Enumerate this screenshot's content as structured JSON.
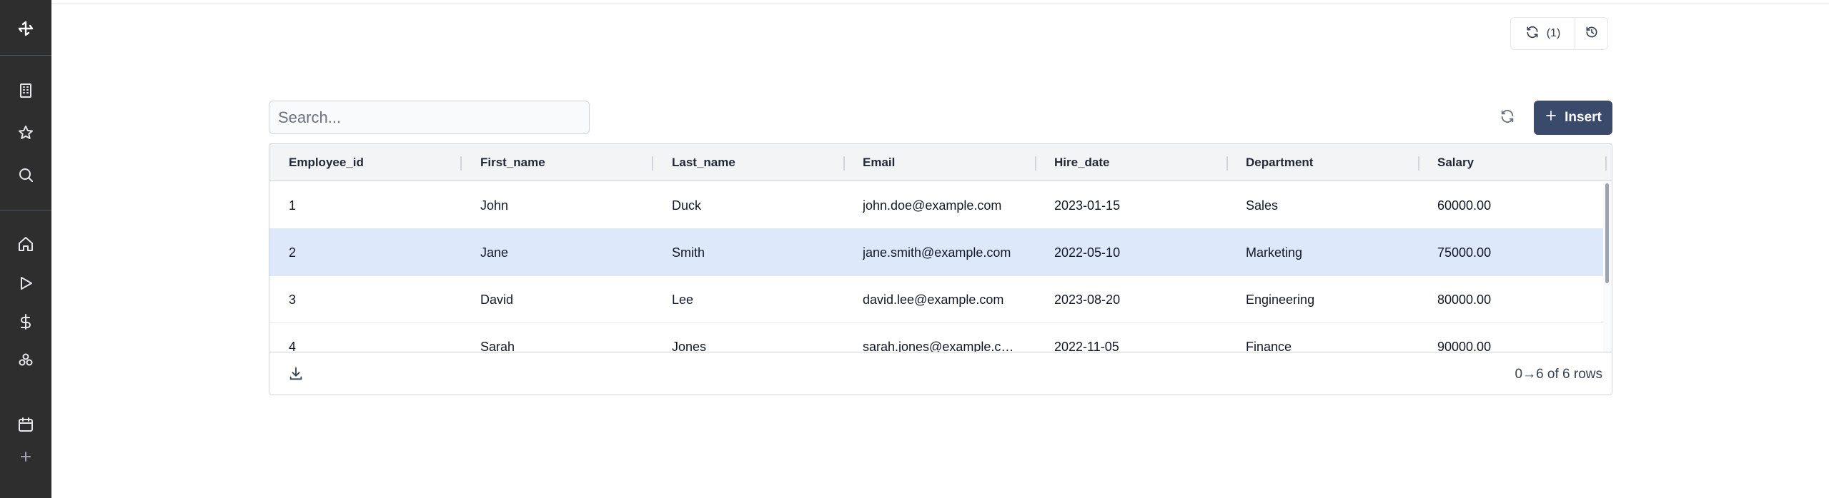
{
  "toolbar": {
    "refresh_count": "(1)"
  },
  "search": {
    "placeholder": "Search..."
  },
  "actions": {
    "insert_label": "Insert"
  },
  "table": {
    "columns": [
      "Employee_id",
      "First_name",
      "Last_name",
      "Email",
      "Hire_date",
      "Department",
      "Salary"
    ],
    "rows": [
      [
        "1",
        "John",
        "Duck",
        "john.doe@example.com",
        "2023-01-15",
        "Sales",
        "60000.00"
      ],
      [
        "2",
        "Jane",
        "Smith",
        "jane.smith@example.com",
        "2022-05-10",
        "Marketing",
        "75000.00"
      ],
      [
        "3",
        "David",
        "Lee",
        "david.lee@example.com",
        "2023-08-20",
        "Engineering",
        "80000.00"
      ],
      [
        "4",
        "Sarah",
        "Jones",
        "sarah.jones@example.c…",
        "2022-11-05",
        "Finance",
        "90000.00"
      ]
    ],
    "selected_row": 2,
    "footer": {
      "pagination": "0→6 of 6 rows"
    }
  },
  "icons": {
    "logo": "logo-icon",
    "sidebar": [
      "building-icon",
      "star-icon",
      "search-icon",
      "home-icon",
      "play-icon",
      "dollar-icon",
      "groups-icon",
      "calendar-icon",
      "plus-icon"
    ],
    "toolbar": [
      "refresh-icon",
      "history-icon"
    ],
    "table_actions": [
      "refresh-icon",
      "plus-icon",
      "download-icon"
    ]
  },
  "colors": {
    "sidebar_bg": "#2e2e2e",
    "insert_button": "#3a4a6b",
    "selected_row": "#dde9fb",
    "header_bg": "#f3f4f6"
  }
}
